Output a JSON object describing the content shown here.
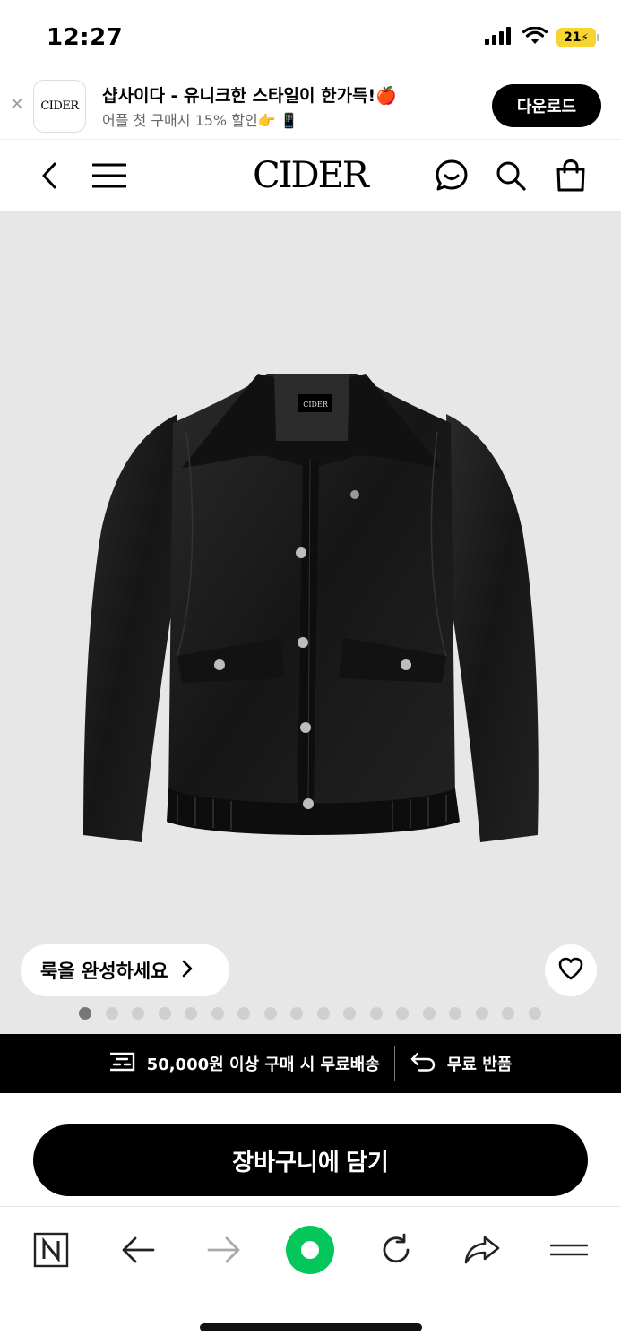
{
  "status_bar": {
    "time": "12:27",
    "battery_level": "21",
    "icons": [
      "signal-icon",
      "wifi-icon",
      "battery-charging-icon"
    ]
  },
  "app_banner": {
    "close_icon": "close-icon",
    "logo_text": "CIDER",
    "title": "샵사이다 - 유니크한 스타일이 한가득!🍎",
    "subtitle": "어플 첫 구매시 15% 할인👉 📱",
    "download_label": "다운로드"
  },
  "header": {
    "logo": "CIDER",
    "icons": [
      "back-icon",
      "menu-icon",
      "chat-icon",
      "search-icon",
      "shopping-bag-icon"
    ]
  },
  "product": {
    "image_label": "CIDER",
    "look_button_label": "룩을 완성하세요",
    "carousel": {
      "total": 18,
      "active": 1
    },
    "colors": {
      "background": "#e7e7e7",
      "jacket": "#1b1b1b"
    }
  },
  "promo_bar": {
    "shipping_text": "50,000원 이상 구매 시 무료배송",
    "return_text": "무료 반품"
  },
  "cart_button_label": "장바구니에 담기",
  "browser_toolbar": {
    "items": [
      "naver-n-icon",
      "back-arrow-icon",
      "forward-arrow-icon",
      "green-dot-icon",
      "refresh-icon",
      "share-icon",
      "menu-icon"
    ],
    "brand_color": "#03c75a"
  }
}
